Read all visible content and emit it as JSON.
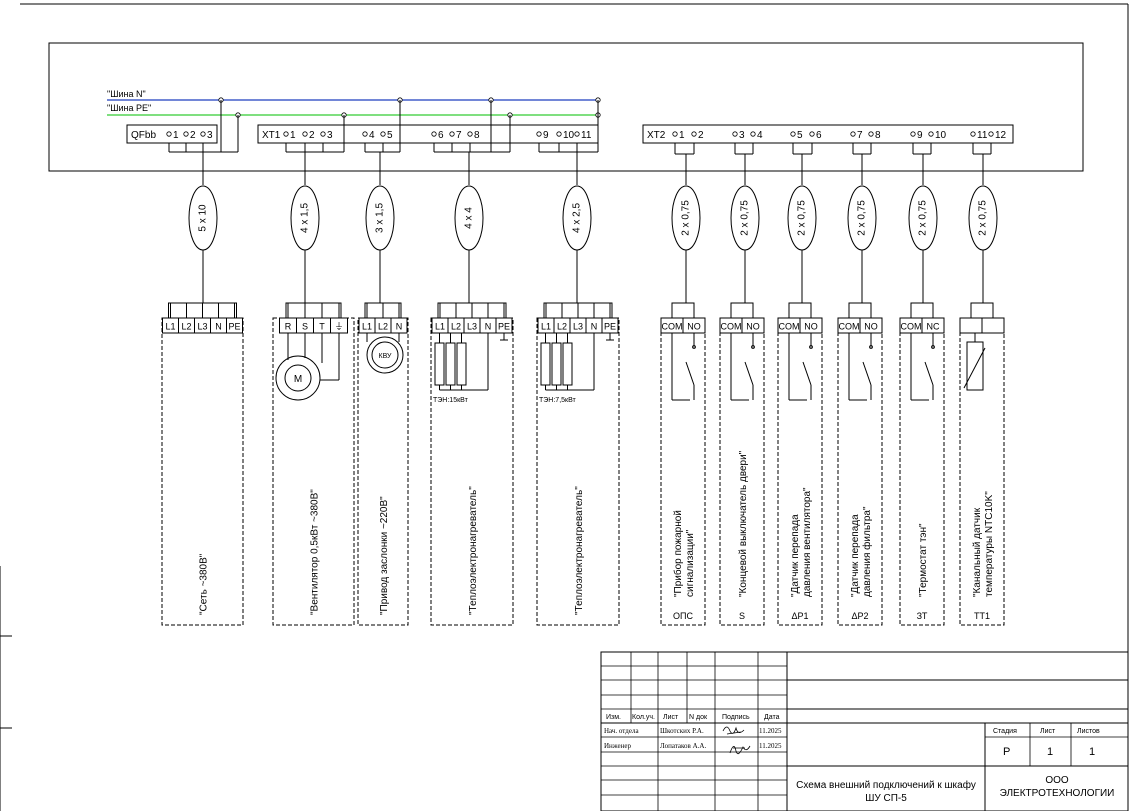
{
  "buses": {
    "n_label": "\"Шина N\"",
    "pe_label": "\"Шина PE\"",
    "n_color": "#1f3fbf",
    "pe_color": "#33cc33"
  },
  "terminal_blocks": {
    "qf": {
      "name": "QFbb",
      "pins": [
        "1",
        "2",
        "3"
      ]
    },
    "xt1": {
      "name": "XT1",
      "pins": [
        "1",
        "2",
        "3",
        "4",
        "5",
        "6",
        "7",
        "8",
        "9",
        "10",
        "11"
      ]
    },
    "xt2": {
      "name": "XT2",
      "pins": [
        "1",
        "2",
        "3",
        "4",
        "5",
        "6",
        "7",
        "8",
        "9",
        "10",
        "11",
        "12"
      ]
    }
  },
  "cables": [
    "5 х 10",
    "4 х 1,5",
    "3 х 1,5",
    "4 х 4",
    "4 х 2,5",
    "2 х 0,75",
    "2 х 0,75",
    "2 х 0,75",
    "2 х 0,75",
    "2 х 0,75",
    "2 х 0,75"
  ],
  "consumers": [
    {
      "pins": [
        "L1",
        "L2",
        "L3",
        "N",
        "PE"
      ],
      "label": "\"Сеть   ~380В\"",
      "tag": ""
    },
    {
      "pins": [
        "R",
        "S",
        "T",
        "⏚"
      ],
      "label": "\"Вентилятор 0,5кВт ~380В\"",
      "tag": "",
      "symbol": "M"
    },
    {
      "pins": [
        "L1",
        "L2",
        "N"
      ],
      "label": "\"Привод заслонки ~220В\"",
      "tag": "",
      "symbol": "КВУ"
    },
    {
      "pins": [
        "L1",
        "L2",
        "L3",
        "N",
        "PE"
      ],
      "label": "\"Теплоэлектронагреватель\"",
      "tag": "",
      "note": "ТЭН:15кВт"
    },
    {
      "pins": [
        "L1",
        "L2",
        "L3",
        "N",
        "PE"
      ],
      "label": "\"Теплоэлектронагреватель\"",
      "tag": "",
      "note": "ТЭН:7,5кВт"
    },
    {
      "pins": [
        "COM",
        "NO"
      ],
      "label1": "\"Прибор пожарной",
      "label2": "сигнализации\"",
      "tag": "ОПС"
    },
    {
      "pins": [
        "COM",
        "NO"
      ],
      "label1": "\"Концевой выключатель двери\"",
      "label2": "",
      "tag": "S"
    },
    {
      "pins": [
        "COM",
        "NO"
      ],
      "label1": "\"Датчик перепада",
      "label2": "давления вентилятора\"",
      "tag": "ΔP1"
    },
    {
      "pins": [
        "COM",
        "NO"
      ],
      "label1": "\"Датчик перепада",
      "label2": "давления фильтра\"",
      "tag": "ΔP2"
    },
    {
      "pins": [
        "COM",
        "NC"
      ],
      "label1": "\"Термостат тэн\"",
      "label2": "",
      "tag": "ЗТ"
    },
    {
      "pins": [
        "",
        ""
      ],
      "label1": "\"Канальный датчик",
      "label2": "температуры NTC10K\"",
      "tag": "TT1"
    }
  ],
  "title_block": {
    "headers": [
      "Изм.",
      "Кол.уч.",
      "Лист",
      "N док",
      "Подпись",
      "Дата"
    ],
    "row1": {
      "role": "Нач. отдела",
      "name": "Шкотских Р.А.",
      "date": "11.2025"
    },
    "row2": {
      "role": "Инженер",
      "name": "Лопатаков А.А.",
      "date": "11.2025"
    },
    "stage_h": "Стадия",
    "sheet_h": "Лист",
    "sheets_h": "Листов",
    "stage": "Р",
    "sheet": "1",
    "sheets": "1",
    "title1": "Схема внешний подключений к шкафу",
    "title2": "ШУ СП-5",
    "org1": "ООО",
    "org2": "ЭЛЕКТРОТЕХНОЛОГИИ"
  }
}
